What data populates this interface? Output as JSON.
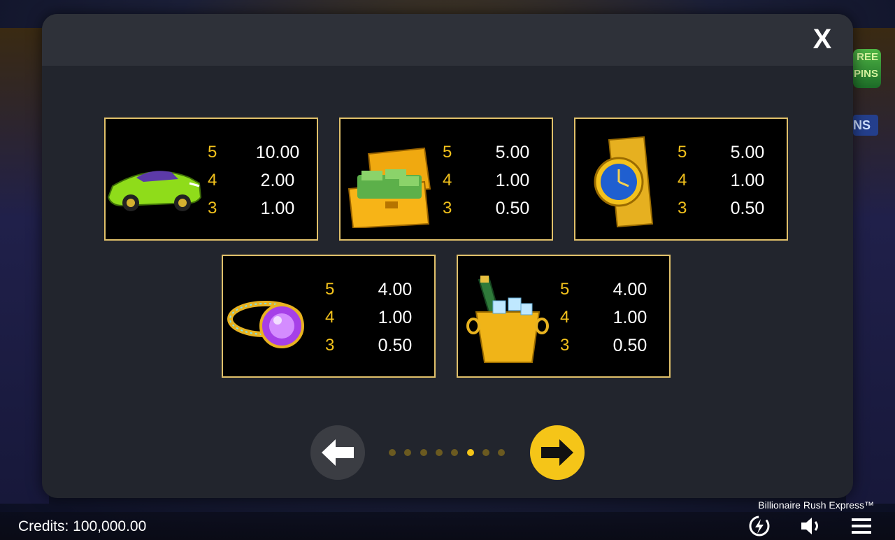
{
  "background": {
    "free_spins_text": "REE\nPINS",
    "bonus_tag_text": "NS"
  },
  "modal": {
    "close_label": "X"
  },
  "paytable": [
    {
      "symbol": "green-sports-car",
      "rows": [
        {
          "count": "5",
          "value": "10.00"
        },
        {
          "count": "4",
          "value": "2.00"
        },
        {
          "count": "3",
          "value": "1.00"
        }
      ]
    },
    {
      "symbol": "cash-suitcase",
      "rows": [
        {
          "count": "5",
          "value": "5.00"
        },
        {
          "count": "4",
          "value": "1.00"
        },
        {
          "count": "3",
          "value": "0.50"
        }
      ]
    },
    {
      "symbol": "gold-watch",
      "rows": [
        {
          "count": "5",
          "value": "5.00"
        },
        {
          "count": "4",
          "value": "1.00"
        },
        {
          "count": "3",
          "value": "0.50"
        }
      ]
    },
    {
      "symbol": "diamond-ring",
      "rows": [
        {
          "count": "5",
          "value": "4.00"
        },
        {
          "count": "4",
          "value": "1.00"
        },
        {
          "count": "3",
          "value": "0.50"
        }
      ]
    },
    {
      "symbol": "champagne-bucket",
      "rows": [
        {
          "count": "5",
          "value": "4.00"
        },
        {
          "count": "4",
          "value": "1.00"
        },
        {
          "count": "3",
          "value": "0.50"
        }
      ]
    }
  ],
  "pagination": {
    "total_pages": 8,
    "current_page": 6
  },
  "footer": {
    "credits_text": "Credits: 100,000.00",
    "game_title": "Billionaire Rush Express™"
  },
  "colors": {
    "accent": "#f5c518",
    "card_border": "#e0c06a",
    "modal_bg": "#22252d"
  },
  "icons": [
    "close-icon",
    "arrow-left-icon",
    "arrow-right-icon",
    "turbo-icon",
    "speaker-icon",
    "menu-icon"
  ]
}
